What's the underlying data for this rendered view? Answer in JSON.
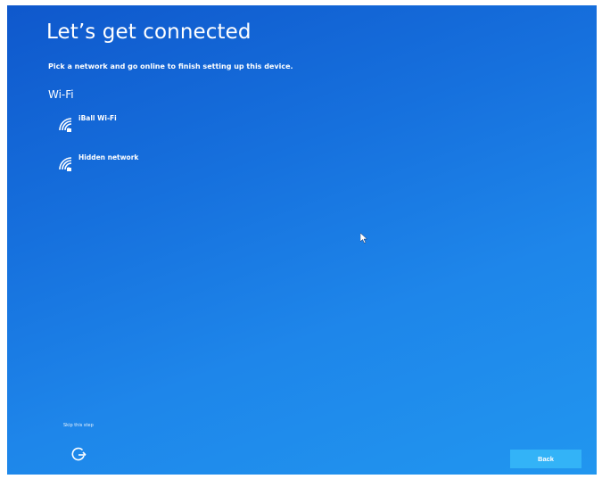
{
  "page": {
    "title": "Let’s get connected",
    "subtitle": "Pick a network and go online to finish setting up this device.",
    "section_label": "Wi-Fi"
  },
  "networks": [
    {
      "name": "iBall Wi-Fi",
      "icon": "wifi-secured-icon"
    },
    {
      "name": "Hidden network",
      "icon": "wifi-secured-icon"
    }
  ],
  "footer": {
    "skip_label": "Skip this step",
    "ease_of_access_icon": "ease-of-access-icon",
    "back_label": "Back"
  },
  "colors": {
    "background_top": "#0f58cc",
    "background_bottom": "#2196ef",
    "button": "#33b3f7",
    "text": "#ffffff"
  }
}
